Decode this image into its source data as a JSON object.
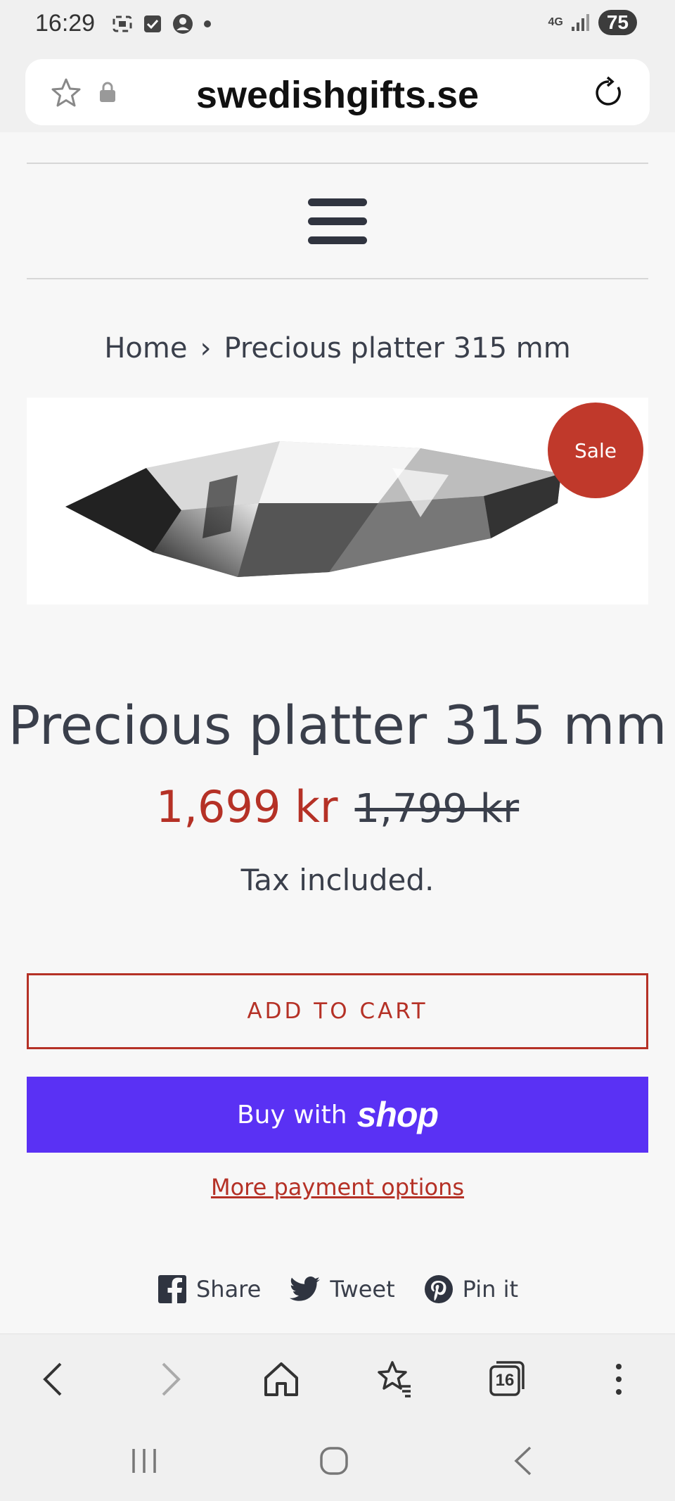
{
  "status_bar": {
    "time": "16:29",
    "network": "4G",
    "battery": "75"
  },
  "browser": {
    "url": "swedishgifts.se"
  },
  "breadcrumb": {
    "home": "Home",
    "separator": "›",
    "current": "Precious platter 315 mm"
  },
  "product": {
    "badge": "Sale",
    "title": "Precious platter 315 mm",
    "sale_price": "1,699 kr",
    "regular_price": "1,799 kr",
    "tax_note": "Tax included."
  },
  "actions": {
    "add_to_cart": "ADD TO CART",
    "buy_with": "Buy with",
    "shop_brand": "shop",
    "more_options": "More payment options"
  },
  "share": {
    "facebook": "Share",
    "twitter": "Tweet",
    "pinterest": "Pin it"
  },
  "browser_nav": {
    "tabs_count": "16"
  },
  "colors": {
    "accent": "#b53126",
    "shop_pay": "#5a31f4",
    "text": "#3a3f4b"
  }
}
